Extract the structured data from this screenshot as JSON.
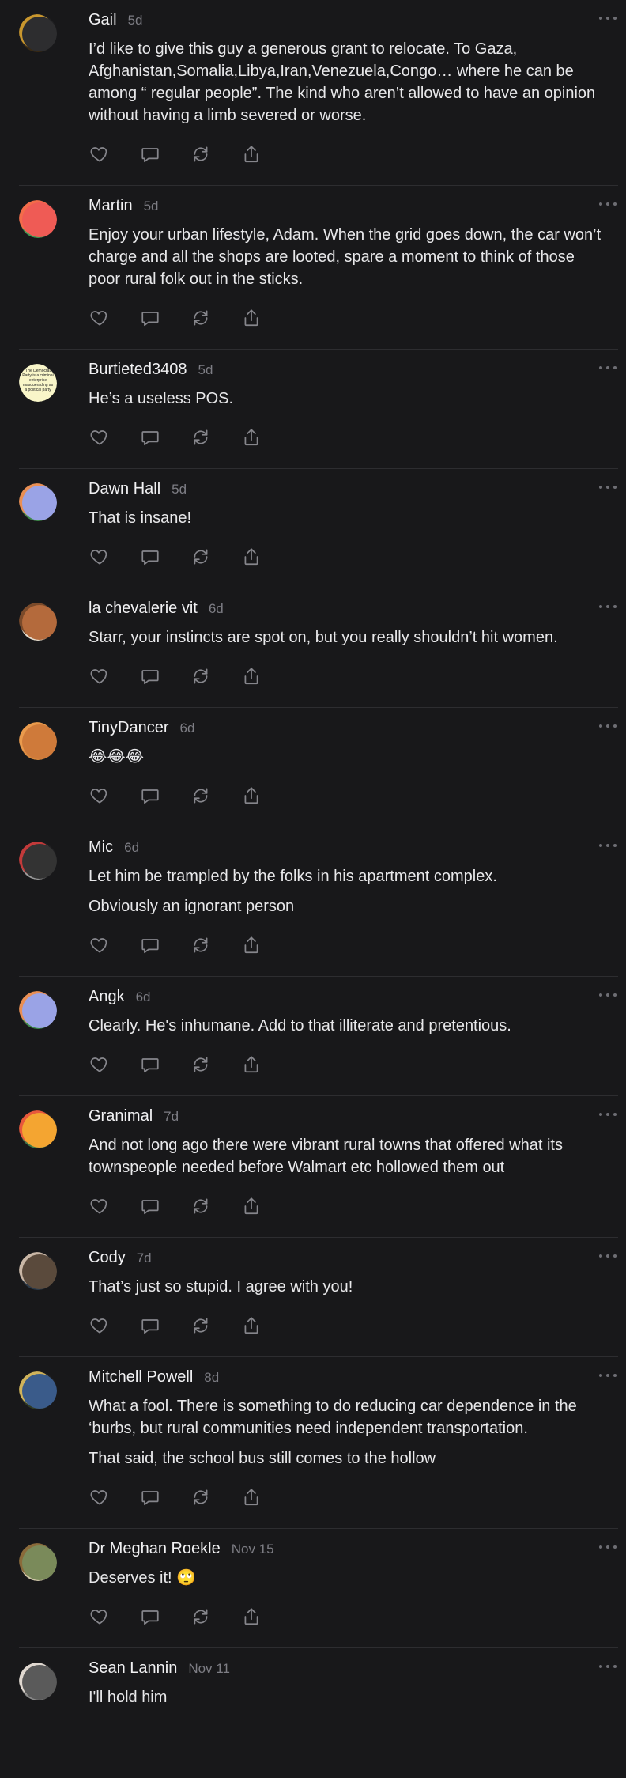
{
  "comments": [
    {
      "name": "Gail",
      "time": "5d",
      "avatar_colors": [
        "#3a2a12",
        "#c9972e",
        "#2d2d2f"
      ],
      "paragraphs": [
        "I’d like to give this guy a generous grant to relocate. To Gaza, Afghanistan,Somalia,Libya,Iran,Venezuela,Congo… where he can be among “ regular people”. The kind who aren’t allowed to have an opinion without having a limb severed or worse."
      ]
    },
    {
      "name": "Martin",
      "time": "5d",
      "avatar_colors": [
        "#3f9a52",
        "#f36c4a",
        "#ef5b55"
      ],
      "paragraphs": [
        "Enjoy your urban lifestyle, Adam. When the grid goes down, the car won’t charge and all the shops are looted, spare a moment to think of those poor rural folk out in the sticks."
      ]
    },
    {
      "name": "Burtieted3408",
      "time": "5d",
      "avatar_colors": [
        "#f9f6c9",
        "#f9f6c9",
        "#f9f6c9"
      ],
      "avatar_text": "The Democrat Party is a criminal enterprise masquerading as a political party",
      "paragraphs": [
        "He’s a useless POS."
      ]
    },
    {
      "name": "Dawn Hall",
      "time": "5d",
      "avatar_colors": [
        "#3e8a4a",
        "#e98f54",
        "#9aa3e6"
      ],
      "paragraphs": [
        "That is insane!"
      ]
    },
    {
      "name": "la chevalerie vit",
      "time": "6d",
      "avatar_colors": [
        "#e9dfcf",
        "#7a4a2a",
        "#b46a3c"
      ],
      "paragraphs": [
        "Starr, your instincts are spot on, but you really shouldn’t hit women."
      ]
    },
    {
      "name": "TinyDancer",
      "time": "6d",
      "avatar_colors": [
        "#d98a3f",
        "#e99a4c",
        "#cf7a3a"
      ],
      "paragraphs": [
        "😂😂😂"
      ]
    },
    {
      "name": "Mic",
      "time": "6d",
      "avatar_colors": [
        "#9c9c9c",
        "#c23a3a",
        "#333333"
      ],
      "paragraphs": [
        "Let him be trampled by the folks in his apartment complex.",
        "Obviously an ignorant person"
      ]
    },
    {
      "name": "Angk",
      "time": "6d",
      "avatar_colors": [
        "#3e8a4a",
        "#e98f54",
        "#9aa3e6"
      ],
      "paragraphs": [
        "Clearly. He's inhumane. Add to that illiterate and pretentious."
      ]
    },
    {
      "name": "Granimal",
      "time": "7d",
      "avatar_colors": [
        "#3e7a4a",
        "#e8583c",
        "#f4a531"
      ],
      "paragraphs": [
        "And not long ago there were vibrant rural towns that offered what its townspeople needed before Walmart etc hollowed them out"
      ]
    },
    {
      "name": "Cody",
      "time": "7d",
      "avatar_colors": [
        "#2b3a4a",
        "#c9b7a6",
        "#5a4a3c"
      ],
      "paragraphs": [
        "That’s just so stupid. I agree with you!"
      ]
    },
    {
      "name": "Mitchell Powell",
      "time": "8d",
      "avatar_colors": [
        "#2f3a22",
        "#d0b35a",
        "#3a5b8a"
      ],
      "paragraphs": [
        "What a fool. There is something to do reducing car dependence in the ‘burbs, but rural communities need independent transportation.",
        "That said, the school bus still comes to the hollow"
      ]
    },
    {
      "name": "Dr Meghan Roekle",
      "time": "Nov 15",
      "avatar_colors": [
        "#cfc6a8",
        "#8a6a3a",
        "#7a8a5a"
      ],
      "paragraphs": [
        "Deserves it! 🙄"
      ]
    },
    {
      "name": "Sean Lannin",
      "time": "Nov 11",
      "avatar_colors": [
        "#8a8a8a",
        "#e0d8d0",
        "#5a5a5a"
      ],
      "paragraphs": [
        "I'll hold him"
      ],
      "no_actions": true
    }
  ],
  "icons": {
    "like": "heart-icon",
    "reply": "comment-bubble-icon",
    "restack": "restack-icon",
    "share": "share-icon",
    "more": "more-dots-icon"
  }
}
